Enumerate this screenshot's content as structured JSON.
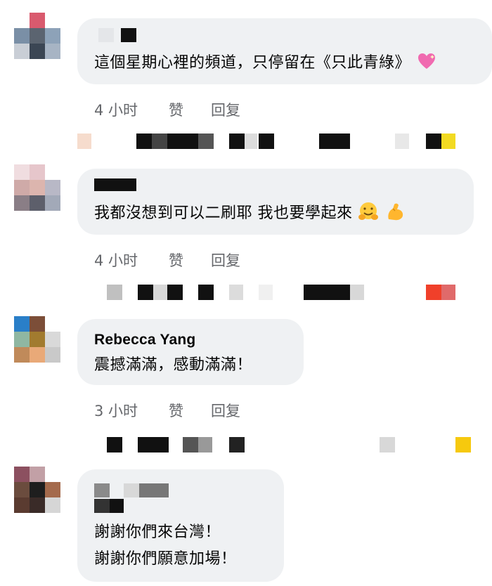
{
  "comments": [
    {
      "author": "",
      "lines": [
        "這個星期心裡的頻道，只停留在《只此青綠》"
      ],
      "emoji": "sparkling-heart-icon",
      "time": "4 小时",
      "like_label": "赞",
      "reply_label": "回复"
    },
    {
      "author": "",
      "lines": [
        "我都沒想到可以二刷耶 我也要學起來"
      ],
      "emoji": "hugging-face-icon, flexed-biceps-icon",
      "time": "4 小时",
      "like_label": "赞",
      "reply_label": "回复"
    },
    {
      "author": "Rebecca Yang",
      "lines": [
        "震撼滿滿，感動滿滿！"
      ],
      "time": "3 小时",
      "like_label": "赞",
      "reply_label": "回复"
    },
    {
      "author": "",
      "lines": [
        "謝謝你們來台灣！",
        "謝謝你們願意加場！"
      ]
    }
  ],
  "colors": {
    "bubble": "#eff1f3",
    "meta_text": "#65676b",
    "body_text": "#050505"
  }
}
